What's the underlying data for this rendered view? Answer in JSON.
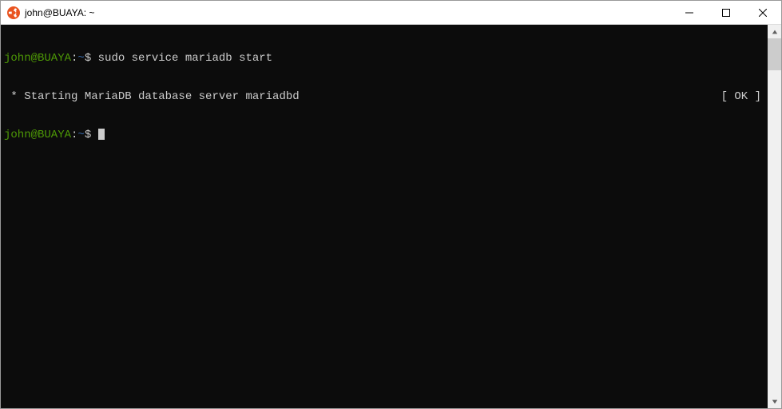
{
  "titlebar": {
    "title": "john@BUAYA: ~"
  },
  "terminal": {
    "line1": {
      "user": "john@BUAYA",
      "colon": ":",
      "path": "~",
      "dollar": "$ ",
      "command": "sudo service mariadb start"
    },
    "line2": {
      "message": " * Starting MariaDB database server mariadbd",
      "status": "[ OK ]"
    },
    "line3": {
      "user": "john@BUAYA",
      "colon": ":",
      "path": "~",
      "dollar": "$ "
    }
  }
}
